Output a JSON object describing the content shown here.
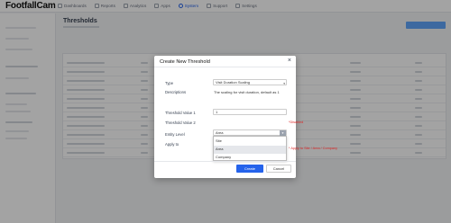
{
  "app": {
    "logo": "FootfallCam"
  },
  "nav": [
    {
      "label": "Dashboards",
      "icon": "dashboard-icon"
    },
    {
      "label": "Reports",
      "icon": "reports-icon"
    },
    {
      "label": "Analytics",
      "icon": "analytics-icon"
    },
    {
      "label": "Apps",
      "icon": "apps-icon"
    },
    {
      "label": "System",
      "icon": "system-icon",
      "active": true
    },
    {
      "label": "Support",
      "icon": "support-icon"
    },
    {
      "label": "Settings",
      "icon": "settings-icon"
    }
  ],
  "main": {
    "title": "Thresholds"
  },
  "modal": {
    "title": "Create New Threshold",
    "close_glyph": "×",
    "type_label": "Type",
    "type_value": "Visit Duration Scaling",
    "descriptions_label": "Descriptions",
    "descriptions_value": "The scaling for visit duration, default as 1",
    "tv1_label": "Threshold Value 1",
    "tv1_value": "1",
    "tv2_label": "Threshold Value 2",
    "tv2_error": "*Disabled",
    "entity_label": "Entity Level",
    "entity_value": "Area",
    "applyto_label": "Apply to",
    "applyto_error": "* Apply to Site / Area / Company",
    "entity_options": [
      "Site",
      "Area",
      "Company"
    ],
    "entity_highlight_index": 1,
    "create_label": "Create",
    "cancel_label": "Cancel"
  },
  "colors": {
    "primary": "#2563eb",
    "error": "#dc2626",
    "overlay": "rgba(0,0,0,0.36)"
  }
}
